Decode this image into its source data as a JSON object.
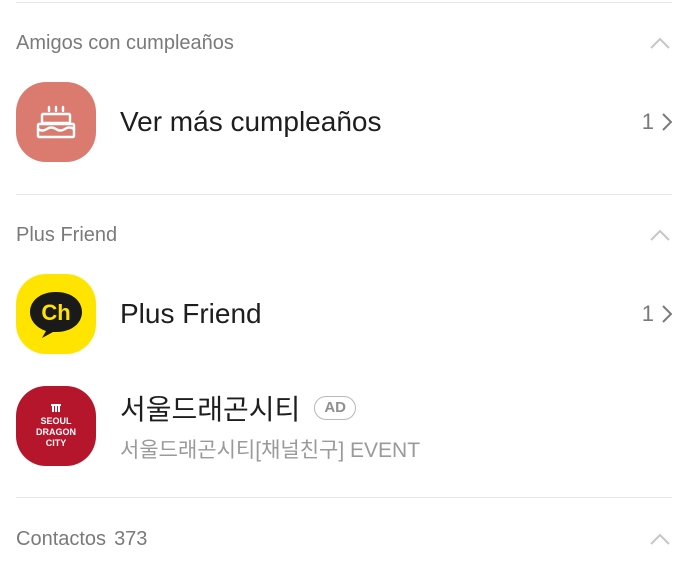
{
  "birthdays": {
    "section_title": "Amigos con cumpleaños",
    "row_label": "Ver más cumpleaños",
    "row_count": "1",
    "icon_color": "#db7b70"
  },
  "plus_friend": {
    "section_title": "Plus Friend",
    "row_label": "Plus Friend",
    "row_count": "1",
    "icon_color": "#ffe400",
    "icon_text": "Ch"
  },
  "ad": {
    "title": "서울드래곤시티",
    "badge": "AD",
    "subtitle": "서울드래곤시티[채널친구] EVENT",
    "logo_lines": [
      "SEOUL",
      "DRAGON",
      "CITY"
    ],
    "icon_color": "#b5162c"
  },
  "contacts": {
    "section_title": "Contactos",
    "count": "373"
  }
}
